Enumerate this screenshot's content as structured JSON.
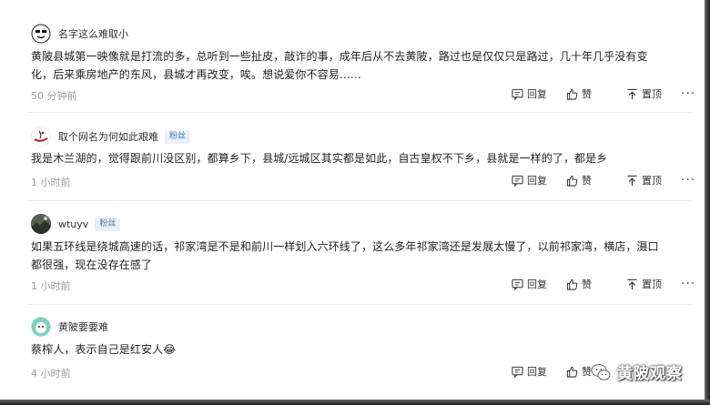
{
  "comments": [
    {
      "username": "名字这么难取小",
      "fan_badge": "",
      "text": "黄陂县城第一映像就是打流的多，总听到一些扯皮，敲诈的事，成年后从不去黄陂，路过也是仅仅只是路过，几十年几乎没有变化，后来乘房地产的东风，县城才再改变，唉。想说爱你不容易……",
      "time": "50 分钟前"
    },
    {
      "username": "取个网名为何如此艰难",
      "fan_badge": "粉丝",
      "text": "我是木兰湖的，觉得跟前川没区别，都算乡下，县城/远城区其实都是如此，自古皇权不下乡，县就是一样的了，都是乡",
      "time": "1 小时前"
    },
    {
      "username": "wtuyv",
      "fan_badge": "粉丝",
      "text": "如果五环线是绕城高速的话，祁家湾是不是和前川一样划入六环线了，这么多年祁家湾还是发展太慢了，以前祁家湾，横店，滠口都很强，现在没存在感了",
      "time": "1 小时前"
    },
    {
      "username": "黄陂要要难",
      "fan_badge": "",
      "text": "蔡榨人，表示自己是红安人😂",
      "time": "4 小时前"
    }
  ],
  "actions": {
    "reply": "回复",
    "like": "赞",
    "top": "置顶",
    "more": "···"
  },
  "watermark": {
    "text": "黄陂观察"
  },
  "colors": {
    "fan_badge_text": "#4e79b8",
    "fan_badge_bg": "#e8f0fb",
    "time": "#999999"
  }
}
